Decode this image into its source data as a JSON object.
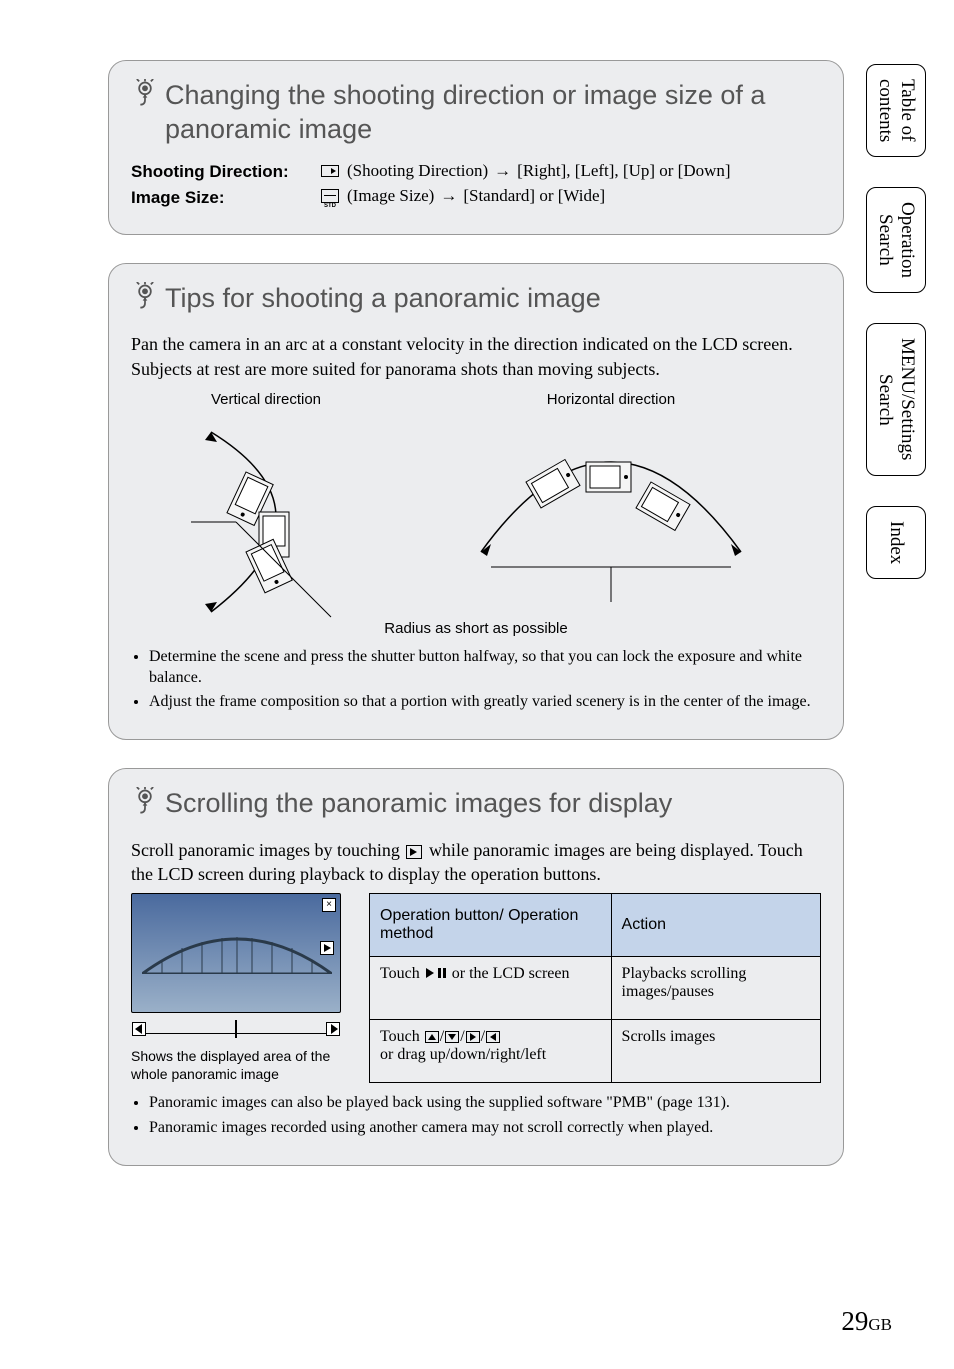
{
  "side_tabs": {
    "toc": "Table of\ncontents",
    "op": "Operation\nSearch",
    "menu": "MENU/Settings\nSearch",
    "index": "Index"
  },
  "card1": {
    "title": "Changing the shooting direction or image size of a panoramic image",
    "row1_label": "Shooting Direction:",
    "row1_val_pre": "(Shooting Direction)",
    "row1_val_post": "[Right], [Left], [Up] or [Down]",
    "row2_label": "Image Size:",
    "row2_val_pre": "(Image Size)",
    "row2_val_post": "[Standard] or [Wide]"
  },
  "card2": {
    "title": "Tips for shooting a panoramic image",
    "body": "Pan the camera in an arc at a constant velocity in the direction indicated on the LCD screen. Subjects at rest are more suited for panorama shots than moving subjects.",
    "vert_label": "Vertical direction",
    "horiz_label": "Horizontal direction",
    "radius": "Radius as short as possible",
    "bullets": [
      "Determine the scene and press the shutter button halfway, so that you can lock the exposure and white balance.",
      "Adjust the frame composition so that a portion with greatly varied scenery is in the center of the image."
    ]
  },
  "card3": {
    "title": "Scrolling the panoramic images for display",
    "intro_pre": "Scroll panoramic images by touching ",
    "intro_post": " while panoramic images are being displayed. Touch the LCD screen during playback to display the operation buttons.",
    "thumb_caption": "Shows the displayed area of the whole panoramic image",
    "table": {
      "h1": "Operation button/ Operation method",
      "h2": "Action",
      "r1_pre": "Touch ",
      "r1_post": " or the LCD screen",
      "r1_act": "Playbacks scrolling images/pauses",
      "r2_pre": "Touch ",
      "r2_post": " or drag up/down/right/left",
      "r2_act": "Scrolls images"
    },
    "bullets": [
      "Panoramic images can also be played back using the supplied software \"PMB\" (page 131).",
      "Panoramic images recorded using another camera may not scroll correctly when played."
    ]
  },
  "page_number": "29",
  "page_region": "GB",
  "size_icon_label": "STD"
}
